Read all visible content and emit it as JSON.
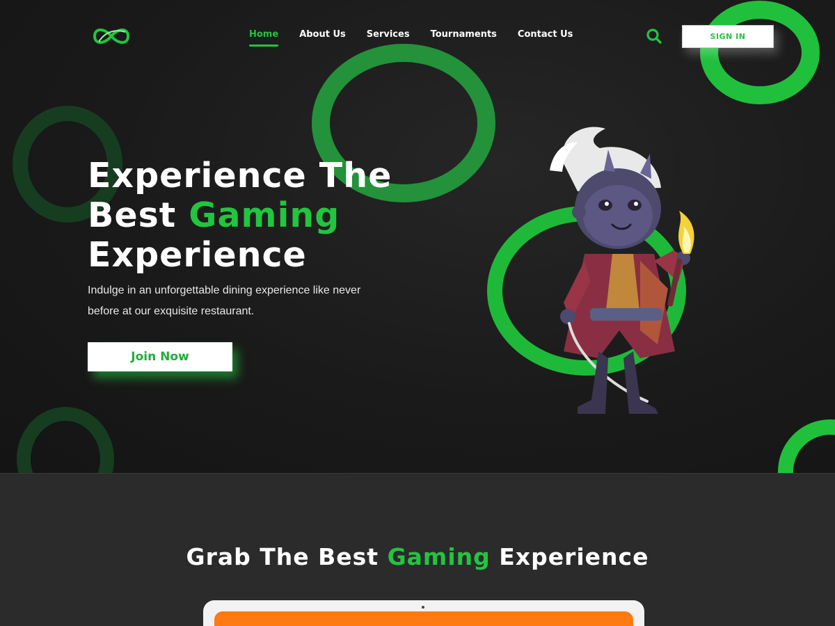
{
  "nav": {
    "items": [
      {
        "label": "Home",
        "active": true
      },
      {
        "label": "About Us",
        "active": false
      },
      {
        "label": "Services",
        "active": false
      },
      {
        "label": "Tournaments",
        "active": false
      },
      {
        "label": "Contact Us",
        "active": false
      }
    ],
    "search_icon": "search-icon",
    "signin_label": "SIGN IN"
  },
  "hero": {
    "title_line1": "Experience The",
    "title_line2_prefix": "Best ",
    "title_line2_accent": "Gaming",
    "title_line3": "Experience",
    "subtitle": "Indulge in an unforgettable dining experience like never before at our exquisite restaurant.",
    "cta_label": "Join Now"
  },
  "section2": {
    "title_prefix": "Grab The Best ",
    "title_accent": "Gaming",
    "title_suffix": " Experience"
  },
  "colors": {
    "accent": "#22c53f",
    "background": "#1b1b1b",
    "section_bg": "#2b2b2b",
    "tablet_screen": "#ff7a12"
  }
}
